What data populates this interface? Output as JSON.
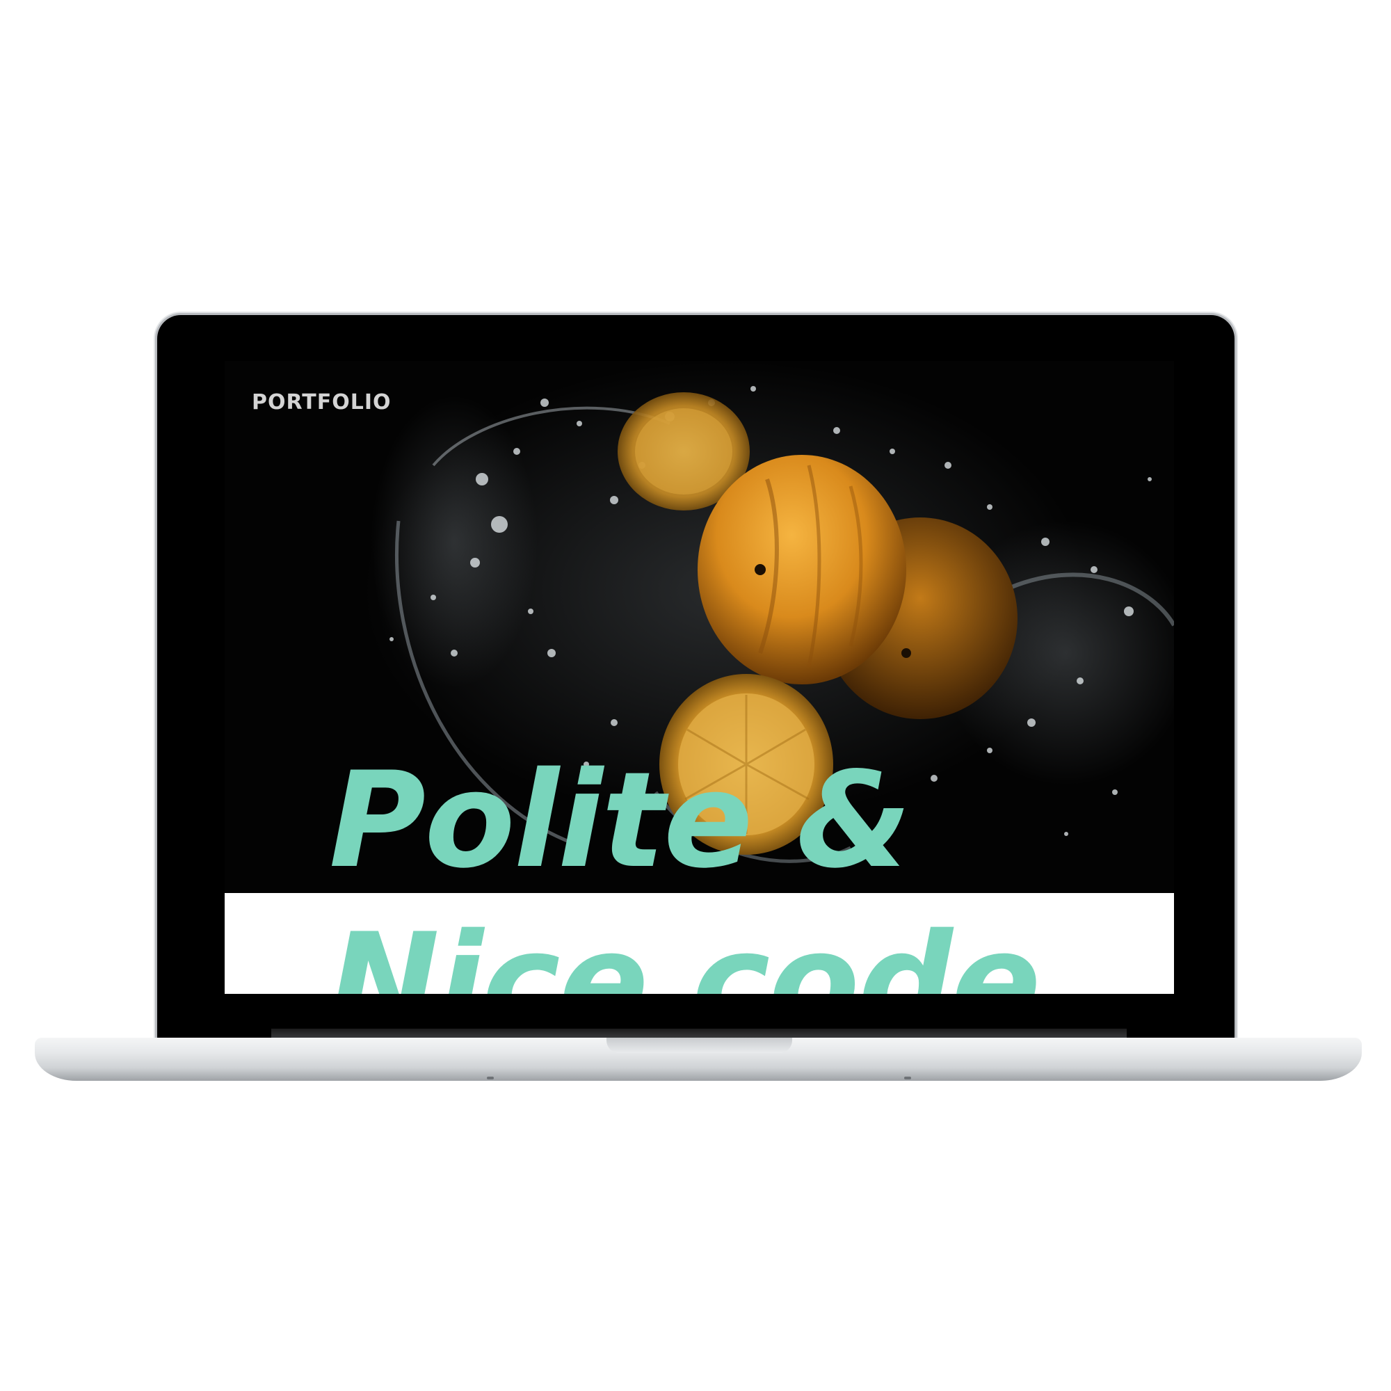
{
  "brand": {
    "label": "PORTFOLIO"
  },
  "hero": {
    "headline_line1": "Polite &",
    "headline_line2": "Nice code"
  },
  "colors": {
    "accent": "#79d5bc",
    "brand_text": "#d4d4d4",
    "hero_background": "#030303",
    "orange": "#e3931f"
  }
}
